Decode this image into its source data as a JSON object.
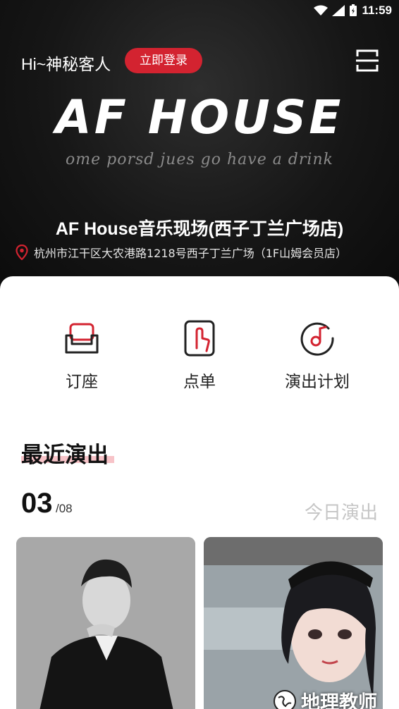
{
  "status_bar": {
    "time": "11:59"
  },
  "header": {
    "greeting": "Hi~神秘客人",
    "login_label": "立即登录",
    "logo_text": "AF HOUSE",
    "tagline": "ome porsd jues go have a drink"
  },
  "store": {
    "name": "AF House音乐现场(西子丁兰广场店)",
    "address": "杭州市江干区大农港路1218号西子丁兰广场（1F山姆会员店）"
  },
  "quick_actions": [
    {
      "label": "订座",
      "icon": "sofa-icon"
    },
    {
      "label": "点单",
      "icon": "tap-hand-icon"
    },
    {
      "label": "演出计划",
      "icon": "music-note-icon"
    }
  ],
  "recent": {
    "title": "最近演出",
    "date_day": "03",
    "date_month": "/08",
    "today_label": "今日演出"
  },
  "watermark": {
    "text": "地理教师"
  },
  "colors": {
    "accent": "#d32330",
    "underline": "#f6b9be"
  }
}
